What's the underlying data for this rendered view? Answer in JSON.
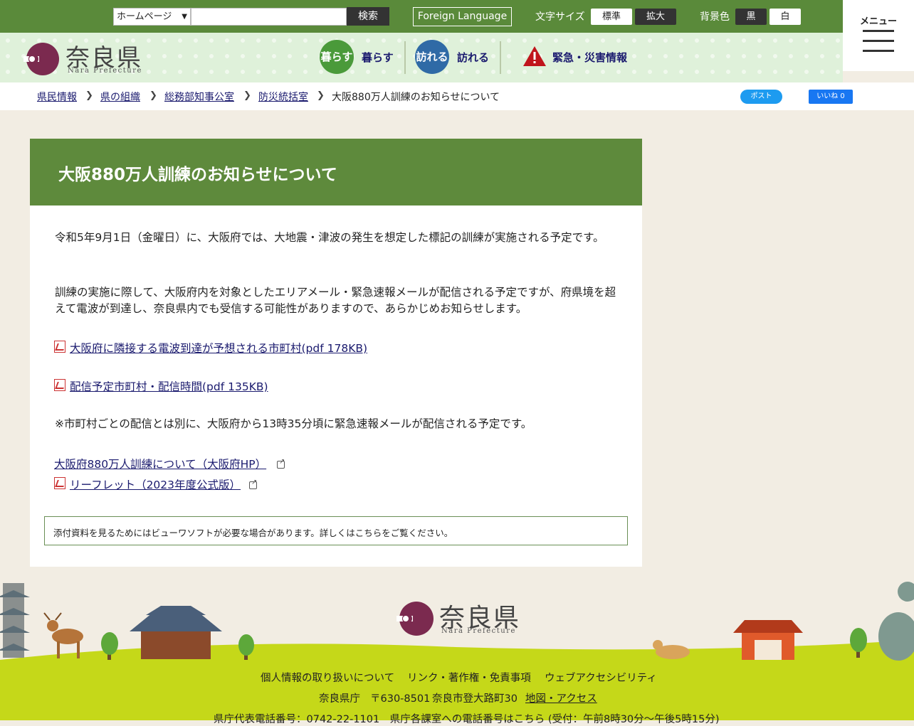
{
  "topbar": {
    "site_select_value": "ホームページ",
    "search_button": "検索",
    "foreign_language": "Foreign Language",
    "font_size_label": "文字サイズ",
    "font_size_standard": "標準",
    "font_size_large": "拡大",
    "bg_color_label": "背景色",
    "bg_black": "黒",
    "bg_white": "白",
    "menu_label": "メニュー"
  },
  "header": {
    "logo_text": "奈良県",
    "logo_sub": "Nara Prefecture",
    "nav": [
      {
        "circle": "暮らす",
        "label": "暮らす",
        "color": "#4a9a3a"
      },
      {
        "circle": "訪れる",
        "label": "訪れる",
        "color": "#2f6aa6"
      },
      {
        "label": "緊急・災害情報",
        "color": "#c0141b"
      }
    ]
  },
  "breadcrumb": {
    "items": [
      "県民情報",
      "県の組織",
      "総務部知事公室",
      "防災統括室"
    ],
    "current": "大阪880万人訓練のお知らせについて",
    "tweet": "ポスト",
    "like": "いいね 0"
  },
  "article": {
    "title": "大阪880万人訓練のお知らせについて",
    "para1": "令和5年9月1日（金曜日）に、大阪府では、大地震・津波の発生を想定した標記の訓練が実施される予定です。",
    "para2": "訓練の実施に際して、大阪府内を対象としたエリアメール・緊急速報メールが配信される予定ですが、府県境を超えて電波が到達し、奈良県内でも受信する可能性がありますので、あらかじめお知らせします。",
    "link1": "大阪府に隣接する電波到達が予想される市町村(pdf 178KB)",
    "link2": "配信予定市町村・配信時間(pdf 135KB)",
    "para3": "※市町村ごとの配信とは別に、大阪府から13時35分頃に緊急速報メールが配信される予定です。",
    "link3": "大阪府880万人訓練について（大阪府HP）",
    "link4": "リーフレット（2023年度公式版）",
    "notice": "添付資料を見るためにはビューワソフトが必要な場合があります。詳しくはこちらをご覧ください。"
  },
  "footer": {
    "logo_text": "奈良県",
    "logo_sub": "Nara Prefecture",
    "links": [
      "個人情報の取り扱いについて",
      "リンク・著作権・免責事項",
      "ウェブアクセシビリティ"
    ],
    "office": "奈良県庁",
    "postal": "〒630-8501",
    "address": "奈良市登大路町30",
    "map_link": "地図・アクセス",
    "phone_line": "県庁代表電話番号：0742-22-1101　県庁各課室への電話番号はこちら (受付：午前8時30分～午後5時15分)"
  }
}
